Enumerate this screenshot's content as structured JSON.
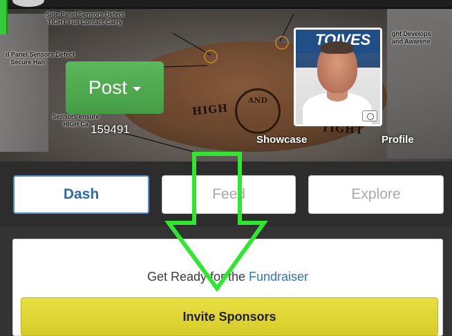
{
  "hero": {
    "annotations": {
      "a1": "Side Panel Sensors Defect\nTIGHT Full Contact Carry",
      "a2": "d Panel Sensors Defect\n   Secure Han",
      "a3": "Sensors ensure\nHIGH Ca",
      "a4": "ght Develops\nand Awarene"
    },
    "football": {
      "word_left": "HIGH",
      "word_right": "TIGHT",
      "circle_top": "AND",
      "circle_bottom": ""
    },
    "avatar_banner": "TOIVES",
    "post_button": {
      "label": "Post"
    },
    "post_count": "159491",
    "showcase_label": "Showcase",
    "profile_label": "Profile"
  },
  "tabs": [
    {
      "label": "Dash",
      "active": true
    },
    {
      "label": "Feed",
      "active": false
    },
    {
      "label": "Explore",
      "active": false
    }
  ],
  "card": {
    "text_prefix": "Get Ready for the ",
    "link_text": "Fundraiser",
    "button_label": "Invite Sponsors"
  },
  "colors": {
    "post_green": "#5cb85c",
    "dash_blue": "#2d6aa8",
    "link_blue": "#2f72c4",
    "invite_yellow": "#e0d634",
    "arrow_green": "#2ee82e"
  },
  "icons": {
    "caret": "chevron-down-icon",
    "camera": "camera-icon",
    "arrow": "arrow-down-icon"
  }
}
